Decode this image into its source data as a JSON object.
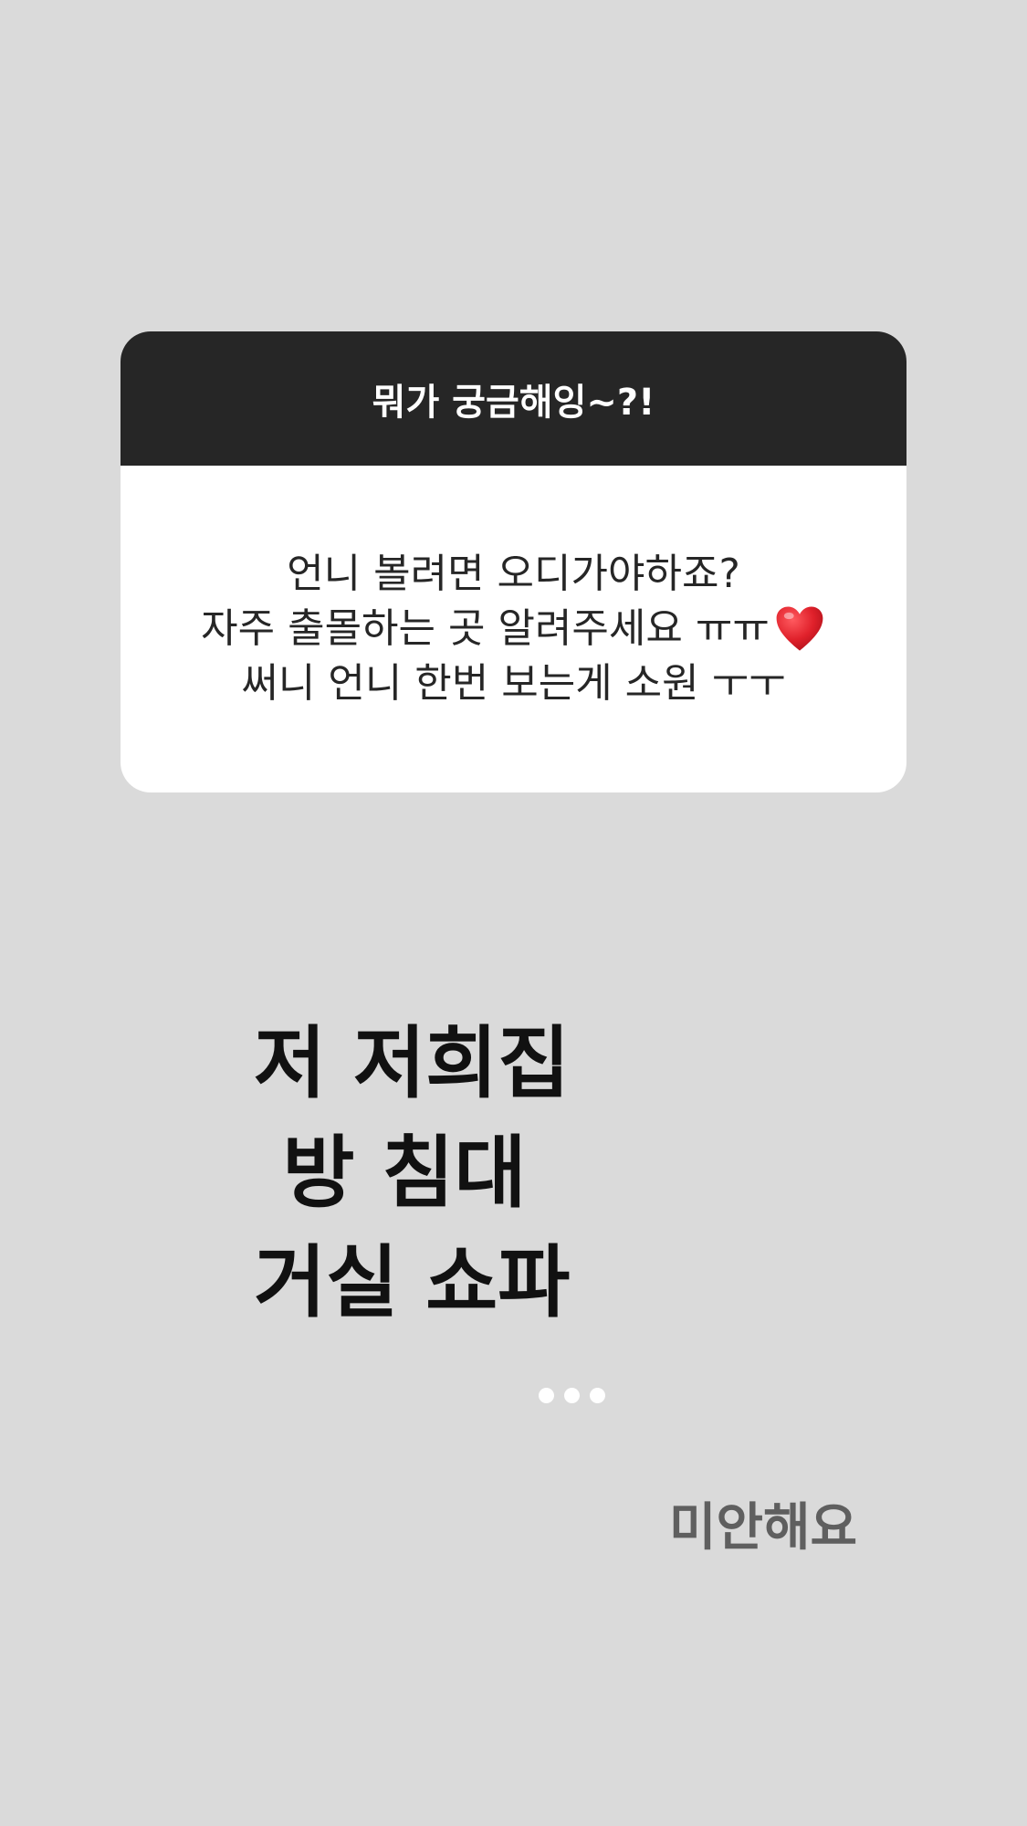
{
  "question_sticker": {
    "prompt": "뭐가 궁금해잉~?!",
    "lines": [
      "언니 볼려면 오디가야하죠?",
      "자주 출몰하는 곳 알려주세요 ㅠㅠ",
      "써니 언니 한번 보는게 소원 ㅜㅜ"
    ],
    "emoji": "red-heart-icon"
  },
  "answer": {
    "lines": [
      "저 저희집",
      "방 침대",
      "거실 쇼파"
    ],
    "ellipsis": "•••",
    "apology": "미안해요"
  },
  "colors": {
    "background": "#dadada",
    "header": "#262626",
    "card": "#ffffff",
    "heart": "#e0212b"
  }
}
